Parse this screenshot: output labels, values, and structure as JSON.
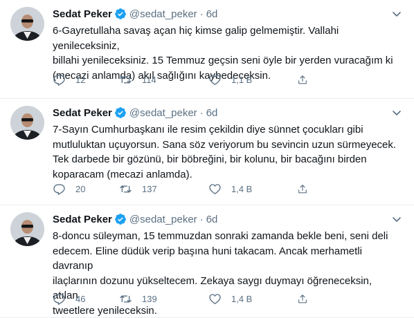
{
  "colors": {
    "verified": "#1da1f2",
    "muted": "#5b7083",
    "text": "#0f1419",
    "divider": "#ebeef0"
  },
  "icons": {
    "verified": "verified-badge-icon",
    "more": "chevron-down-icon",
    "reply": "reply-icon",
    "retweet": "retweet-icon",
    "like": "heart-icon",
    "share": "share-icon"
  },
  "tweets": [
    {
      "name": "Sedat Peker",
      "handle": "@sedat_peker",
      "separator": "·",
      "time": "6d",
      "text": "6-Gayretullaha savaş açan hiç kimse galip gelmemiştir. Vallahi yenileceksiniz,\nbillahi yenileceksiniz. 15 Temmuz geçsin seni öyle bir yerden vuracağım ki\n(mecazi anlamda) akıl sağlığını kaybedeceksin.",
      "replies": "12",
      "retweets": "114",
      "likes": "1,1 B"
    },
    {
      "name": "Sedat Peker",
      "handle": "@sedat_peker",
      "separator": "·",
      "time": "6d",
      "text": "7-Sayın Cumhurbaşkanı ile resim çekildin diye sünnet çocukları gibi\nmutluluktan uçuyorsun. Sana söz veriyorum bu sevincin uzun sürmeyecek.\nTek darbede bir gözünü, bir böbreğini, bir kolunu, bir bacağını birden\nkoparacam (mecazi anlamda).",
      "replies": "20",
      "retweets": "137",
      "likes": "1,4 B"
    },
    {
      "name": "Sedat Peker",
      "handle": "@sedat_peker",
      "separator": "·",
      "time": "6d",
      "text": "8-doncu süleyman, 15 temmuzdan sonraki zamanda bekle beni, seni deli\nedecem. Eline düdük verip başına huni takacam. Ancak merhametli davranıp\nilaçlarının dozunu yükseltecem. Zekaya saygı duymayı öğreneceksin, atılan\ntweetlere yenileceksin.",
      "replies": "46",
      "retweets": "139",
      "likes": "1,4 B"
    }
  ]
}
